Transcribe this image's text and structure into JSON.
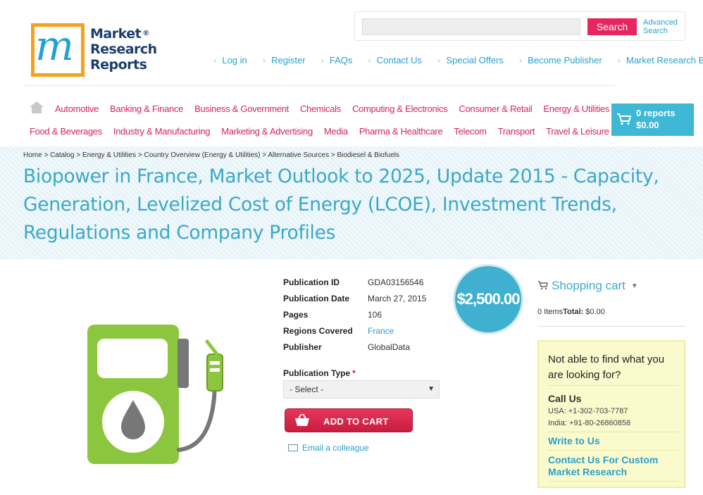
{
  "logo": {
    "line1": "Market",
    "line2": "Research",
    "line3": "Reports",
    "reg": "®",
    "mark": "m"
  },
  "search": {
    "placeholder": "",
    "button": "Search",
    "advanced": "Advanced Search"
  },
  "top_links": [
    "Log in",
    "Register",
    "FAQs",
    "Contact Us",
    "Special Offers",
    "Become Publisher",
    "Market Research Blog"
  ],
  "categories_row1": [
    "Automotive",
    "Banking & Finance",
    "Business & Government",
    "Chemicals",
    "Computing & Electronics",
    "Consumer & Retail",
    "Energy & Utilities"
  ],
  "categories_row2": [
    "Food & Beverages",
    "Industry & Manufacturing",
    "Marketing & Advertising",
    "Media",
    "Pharma & Healthcare",
    "Telecom",
    "Transport",
    "Travel & Leisure"
  ],
  "cart_summary": {
    "reports": "0 reports",
    "amount": "$0.00"
  },
  "breadcrumb": "Home > Catalog > Energy & Utilities > Country Overview (Energy & Utilities) > Alternative Sources > Biodiesel & Biofuels",
  "title": "Biopower in France, Market Outlook to 2025, Update 2015 - Capacity, Generation, Levelized Cost of Energy (LCOE), Investment Trends, Regulations and Company Profiles",
  "publication": {
    "id_label": "Publication ID",
    "id": "GDA03156546",
    "date_label": "Publication Date",
    "date": "March 27, 2015",
    "pages_label": "Pages",
    "pages": "106",
    "regions_label": "Regions Covered",
    "regions": "France",
    "publisher_label": "Publisher",
    "publisher": "GlobalData"
  },
  "price": "$2,500.00",
  "publication_type": {
    "label": "Publication Type",
    "required": "*",
    "selected": "- Select -"
  },
  "add_to_cart": "ADD TO CART",
  "email_colleague": "Email a colleague",
  "shopping_cart": {
    "title": "Shopping cart",
    "items": "0 Items",
    "total_label": "Total:",
    "total": "$0.00"
  },
  "help": {
    "question": "Not able to find what you are looking for?",
    "call_title": "Call Us",
    "usa": "USA: +1-302-703-7787",
    "india": "India: +91-80-26860858",
    "write": "Write to Us",
    "custom": "Contact Us For Custom Market Research"
  },
  "colors": {
    "accent": "#3fb8d6",
    "category": "#d6245a",
    "title": "#3aa8c9",
    "cart_button": "#d6254a",
    "help_bg": "#fafacd"
  }
}
